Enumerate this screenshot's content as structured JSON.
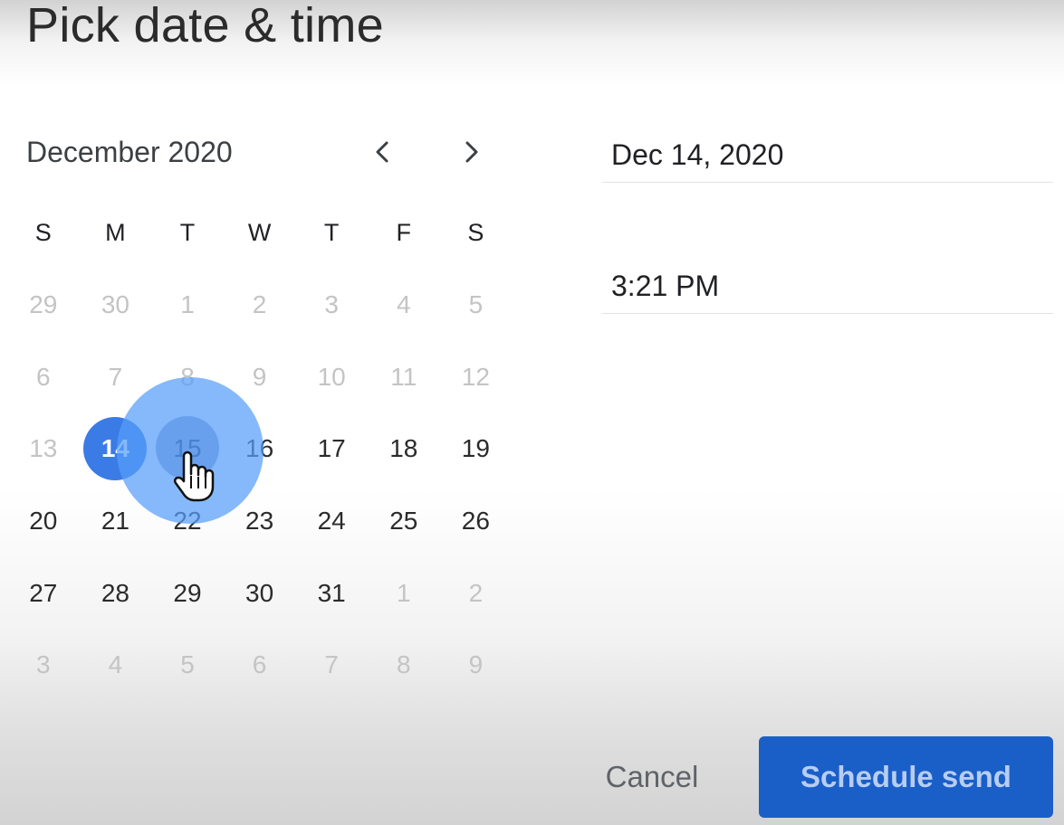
{
  "dialog": {
    "title": "Pick date & time"
  },
  "calendar": {
    "month_label": "December 2020",
    "weekdays": [
      "S",
      "M",
      "T",
      "W",
      "T",
      "F",
      "S"
    ],
    "weeks": [
      [
        {
          "d": "29",
          "m": true
        },
        {
          "d": "30",
          "m": true
        },
        {
          "d": "1",
          "m": true
        },
        {
          "d": "2",
          "m": true
        },
        {
          "d": "3",
          "m": true
        },
        {
          "d": "4",
          "m": true
        },
        {
          "d": "5",
          "m": true
        }
      ],
      [
        {
          "d": "6",
          "m": true
        },
        {
          "d": "7",
          "m": true
        },
        {
          "d": "8",
          "m": true
        },
        {
          "d": "9",
          "m": true
        },
        {
          "d": "10",
          "m": true
        },
        {
          "d": "11",
          "m": true
        },
        {
          "d": "12",
          "m": true
        }
      ],
      [
        {
          "d": "13",
          "m": true
        },
        {
          "d": "14",
          "m": false,
          "selected": true
        },
        {
          "d": "15",
          "m": false
        },
        {
          "d": "16",
          "m": false
        },
        {
          "d": "17",
          "m": false
        },
        {
          "d": "18",
          "m": false
        },
        {
          "d": "19",
          "m": false
        }
      ],
      [
        {
          "d": "20",
          "m": false
        },
        {
          "d": "21",
          "m": false
        },
        {
          "d": "22",
          "m": false
        },
        {
          "d": "23",
          "m": false
        },
        {
          "d": "24",
          "m": false
        },
        {
          "d": "25",
          "m": false
        },
        {
          "d": "26",
          "m": false
        }
      ],
      [
        {
          "d": "27",
          "m": false
        },
        {
          "d": "28",
          "m": false
        },
        {
          "d": "29",
          "m": false
        },
        {
          "d": "30",
          "m": false
        },
        {
          "d": "31",
          "m": false
        },
        {
          "d": "1",
          "m": true
        },
        {
          "d": "2",
          "m": true
        }
      ],
      [
        {
          "d": "3",
          "m": true
        },
        {
          "d": "4",
          "m": true
        },
        {
          "d": "5",
          "m": true
        },
        {
          "d": "6",
          "m": true
        },
        {
          "d": "7",
          "m": true
        },
        {
          "d": "8",
          "m": true
        },
        {
          "d": "9",
          "m": true
        }
      ]
    ],
    "selected_color": "#3b7be6",
    "hover_color": "#569efa"
  },
  "fields": {
    "date_value": "Dec 14, 2020",
    "time_value": "3:21 PM"
  },
  "actions": {
    "cancel_label": "Cancel",
    "schedule_label": "Schedule send",
    "primary_color": "#1a5fc8"
  },
  "icons": {
    "prev": "chevron-left-icon",
    "next": "chevron-right-icon",
    "cursor": "hand-pointer-icon"
  }
}
